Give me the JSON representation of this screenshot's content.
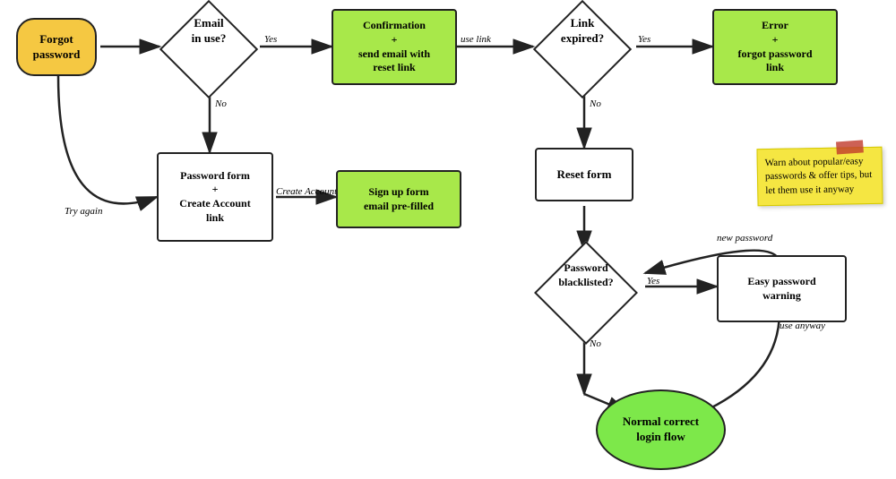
{
  "nodes": {
    "forgot_password": {
      "label": "Forgot\npassword",
      "bg": "yellow"
    },
    "email_in_use": {
      "label": "Email\nin use?"
    },
    "confirmation": {
      "label": "Confirmation\n+\nsend email with\nreset link",
      "bg": "green"
    },
    "link_expired": {
      "label": "Link\nexpired?"
    },
    "error": {
      "label": "Error\n+\nforgot password\nlink",
      "bg": "green"
    },
    "password_form": {
      "label": "Password form\n+\nCreate Account\nlink"
    },
    "signup_form": {
      "label": "Sign up form\nemail pre-filled",
      "bg": "green"
    },
    "reset_form": {
      "label": "Reset form"
    },
    "password_blacklisted": {
      "label": "Password\nblacklisted?"
    },
    "easy_password_warning": {
      "label": "Easy password\nwarning"
    },
    "normal_correct": {
      "label": "Normal correct\nlogin flow",
      "bg": "bright-green"
    }
  },
  "labels": {
    "yes": "Yes",
    "no": "No",
    "use_link": "use link",
    "create_account": "Create Account",
    "try_again": "Try again",
    "new_password": "new password",
    "use_anyway": "use anyway"
  },
  "sticky": {
    "text": "Warn about popular/easy passwords & offer tips, but let them use it anyway"
  }
}
